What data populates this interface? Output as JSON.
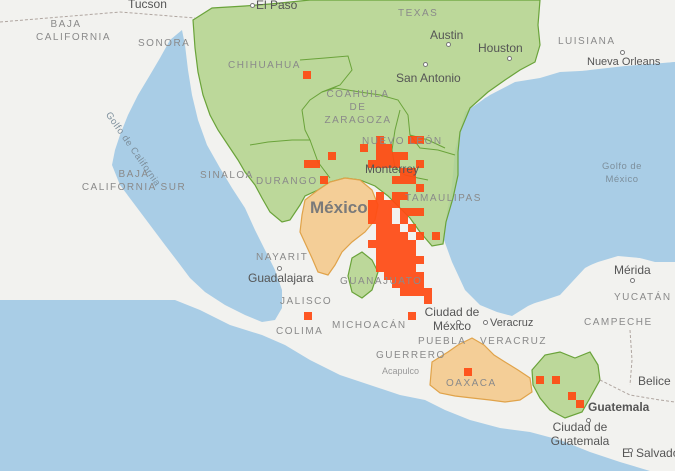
{
  "map": {
    "labels": {
      "tucson": "Tucson",
      "el_paso": "El Paso",
      "texas": "TEXAS",
      "austin": "Austin",
      "houston": "Houston",
      "san_antonio": "San Antonio",
      "louisiana": "LUISIANA",
      "nueva_orleans": "Nueva Orleans",
      "baja_california": "BAJA CALIFORNIA",
      "sonora": "SONORA",
      "chihuahua": "CHIHUAHUA",
      "coahuila": "COAHUILA DE ZARAGOZA",
      "nuevo_leon": "NUEVO LEÓN",
      "monterrey": "Monterrey",
      "tamaulipas": "TAMAULIPAS",
      "golfo_california": "Golfo de California",
      "baja_california_sur": "BAJA CALIFORNIA SUR",
      "sinaloa": "SINALOA",
      "durango": "DURANGO",
      "mexico": "México",
      "golfo_mexico": "Golfo de México",
      "nayarit": "NAYARIT",
      "guadalajara": "Guadalajara",
      "guanajuato": "GUANAJUATO",
      "jalisco": "JALISCO",
      "colima": "COLIMA",
      "michoacan": "MICHOACÁN",
      "ciudad_mexico": "Ciudad de México",
      "veracruz_city": "Veracruz",
      "veracruz_state": "VERACRUZ",
      "puebla": "PUEBLA",
      "guerrero": "GUERRERO",
      "acapulco": "Acapulco",
      "oaxaca": "OAXACA",
      "merida": "Mérida",
      "yucatan": "YUCATÁN",
      "campeche": "CAMPECHE",
      "belice": "Belice",
      "guatemala": "Guatemala",
      "ciudad_guatemala": "Ciudad de Guatemala",
      "el_salvador": "El Salvador"
    },
    "colors": {
      "land": "#f2f2ef",
      "water": "#a9cde6",
      "green_region_fill": "#b3d48b",
      "green_region_stroke": "#6aa33a",
      "orange_region_fill": "#f4c887",
      "orange_region_stroke": "#e0a34a",
      "occurrence_cell": "#ff4a12"
    }
  }
}
